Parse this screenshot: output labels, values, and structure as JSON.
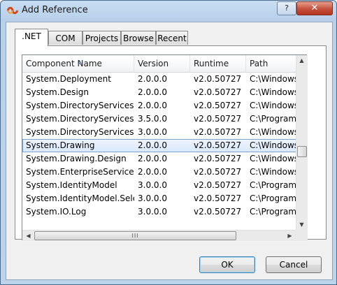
{
  "window": {
    "title": "Add Reference",
    "help_label": "?",
    "close_label": "✕"
  },
  "tabs": [
    {
      "label": ".NET",
      "active": true
    },
    {
      "label": "COM",
      "active": false
    },
    {
      "label": "Projects",
      "active": false
    },
    {
      "label": "Browse",
      "active": false
    },
    {
      "label": "Recent",
      "active": false
    }
  ],
  "list": {
    "columns": [
      "Component Name",
      "Version",
      "Runtime",
      "Path"
    ],
    "sorted_column": "Component Name",
    "rows": [
      [
        "System.Deployment",
        "2.0.0.0",
        "v2.0.50727",
        "C:\\Windows\\"
      ],
      [
        "System.Design",
        "2.0.0.0",
        "v2.0.50727",
        "C:\\Windows\\"
      ],
      [
        "System.DirectoryServices",
        "2.0.0.0",
        "v2.0.50727",
        "C:\\Windows\\"
      ],
      [
        "System.DirectoryServices....",
        "3.5.0.0",
        "v2.0.50727",
        "C:\\Program"
      ],
      [
        "System.DirectoryServices.P...",
        "3.0.0.0",
        "v2.0.50727",
        "C:\\Windows\\"
      ],
      [
        "System.Drawing",
        "2.0.0.0",
        "v2.0.50727",
        "C:\\Windows\\"
      ],
      [
        "System.Drawing.Design",
        "2.0.0.0",
        "v2.0.50727",
        "C:\\Windows\\"
      ],
      [
        "System.EnterpriseServices",
        "2.0.0.0",
        "v2.0.50727",
        "C:\\Windows\\"
      ],
      [
        "System.IdentityModel",
        "3.0.0.0",
        "v2.0.50727",
        "C:\\Program"
      ],
      [
        "System.IdentityModel.Sele...",
        "3.0.0.0",
        "v2.0.50727",
        "C:\\Program"
      ],
      [
        "System.IO.Log",
        "3.0.0.0",
        "v2.0.50727",
        "C:\\Program"
      ]
    ],
    "selected_row": "System.Drawing",
    "hscroll_grip": "III"
  },
  "buttons": {
    "ok_label": "OK",
    "cancel_label": "Cancel"
  },
  "colors": {
    "selection": "#d9e8fb",
    "close_button": "#c6503b"
  }
}
